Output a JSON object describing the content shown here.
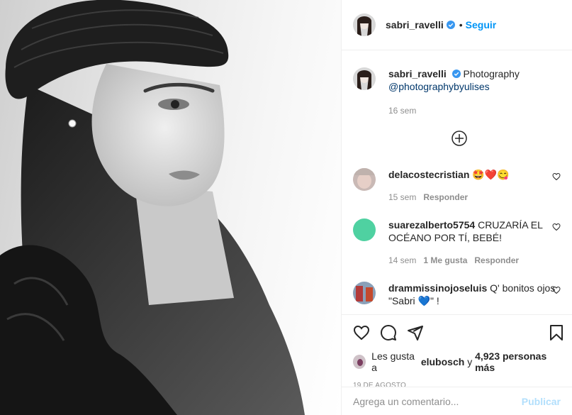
{
  "post": {
    "author": "sabri_ravelli",
    "follow_sep": "•",
    "follow_label": "Seguir",
    "caption_word": "Photography",
    "caption_mention": "@photographybyulises",
    "caption_time": "16 sem"
  },
  "comments": [
    {
      "user": "delacostecristian",
      "text": "🤩❤️😋",
      "time": "15 sem",
      "likes": "",
      "reply": "Responder"
    },
    {
      "user": "suarezalberto5754",
      "text": "CRUZARÍA EL OCÉANO POR TÍ, BEBÉ!",
      "time": "14 sem",
      "likes": "1 Me gusta",
      "reply": "Responder"
    },
    {
      "user": "drammissinojoseluis",
      "text": "Q' bonitos ojos \"Sabri 💙\" !",
      "time": "",
      "likes": "",
      "reply": ""
    }
  ],
  "likes_line": {
    "prefix": "Les gusta a",
    "user": "elubosch",
    "mid": "y",
    "count": "4,923 personas más"
  },
  "date": "19 DE AGOSTO",
  "add_comment": {
    "placeholder": "Agrega un comentario...",
    "publish_label": "Publicar"
  },
  "icons": [
    "heart-icon",
    "comment-icon",
    "share-icon",
    "bookmark-icon",
    "verified-icon",
    "plus-circle-icon"
  ],
  "colors": {
    "accent": "#0095f6",
    "publish_disabled": "#b2dffc",
    "muted": "#8e8e8e",
    "border": "#efefef"
  }
}
